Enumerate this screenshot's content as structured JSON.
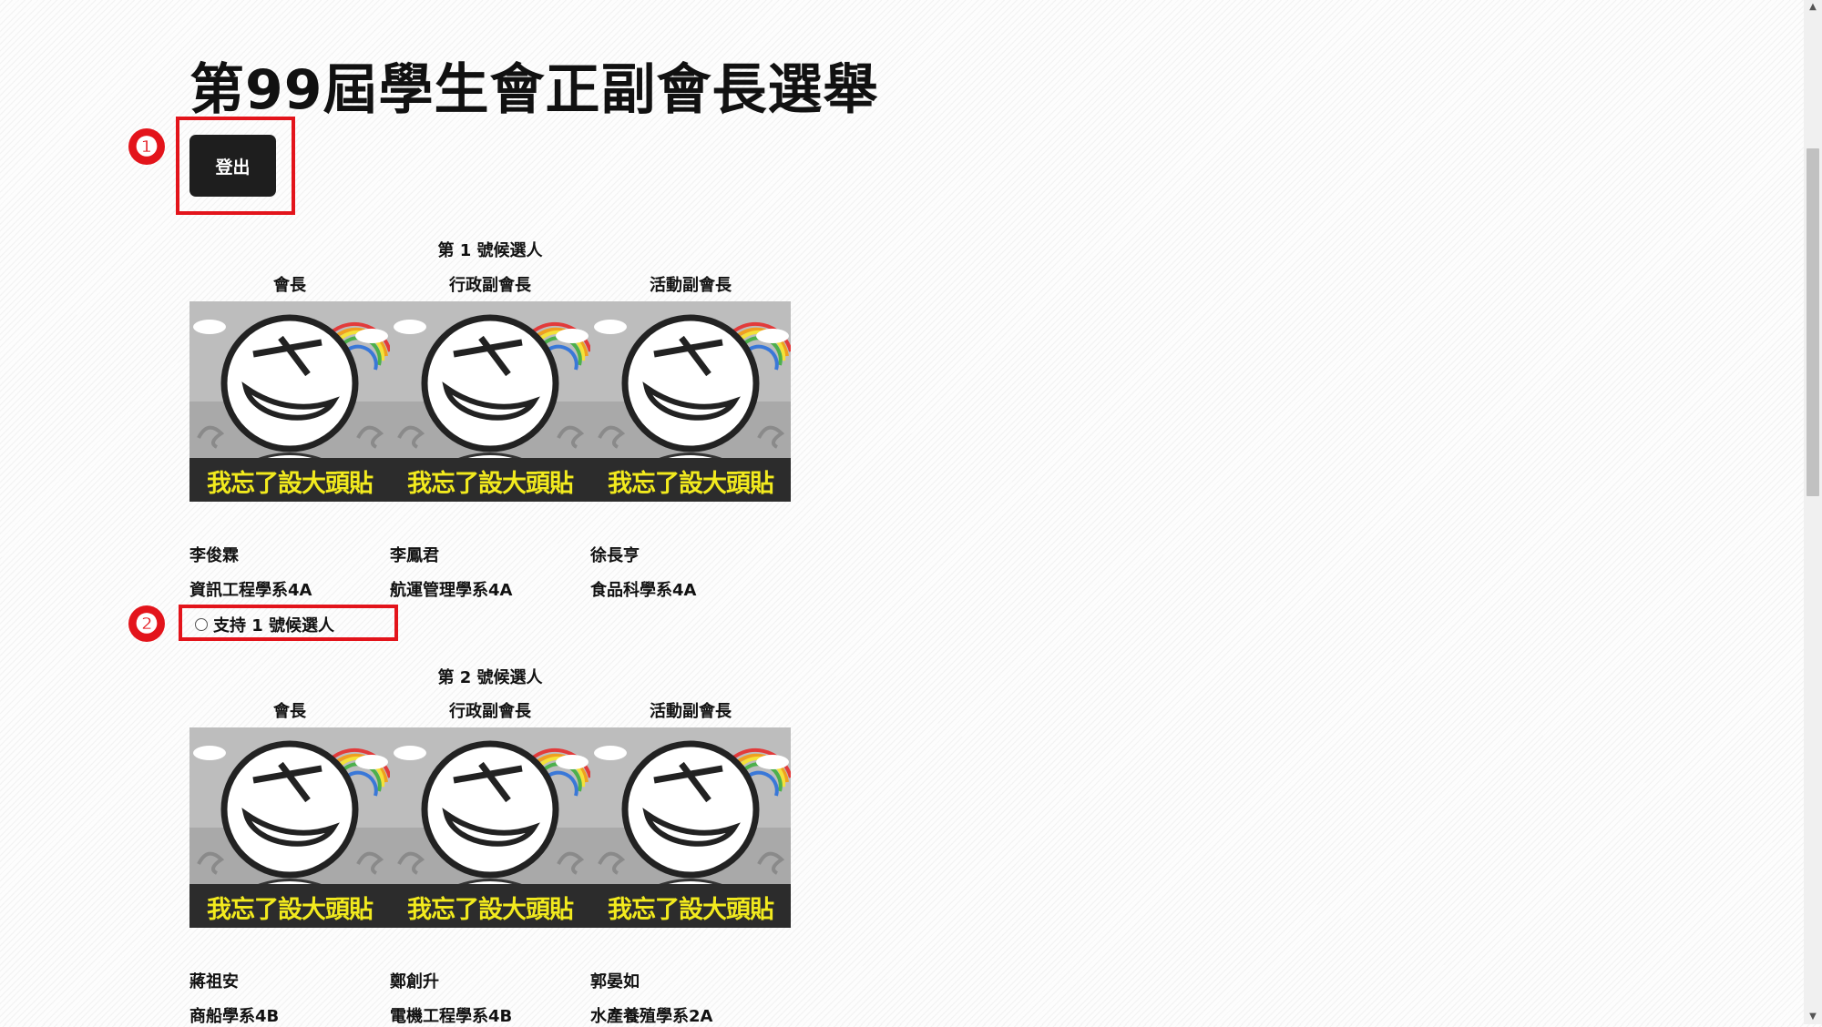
{
  "page_title": "第99屆學生會正副會長選舉",
  "logout_label": "登出",
  "callouts": [
    "❶",
    "❷"
  ],
  "photo_caption": "我忘了設大頭貼",
  "candidates": [
    {
      "group_title": "第 1 號候選人",
      "roles": [
        "會長",
        "行政副會長",
        "活動副會長"
      ],
      "names": [
        "李俊霖",
        "李鳳君",
        "徐長亨"
      ],
      "departments": [
        "資訊工程學系4A",
        "航運管理學系4A",
        "食品科學系4A"
      ],
      "support_label": "支持 1 號候選人"
    },
    {
      "group_title": "第 2 號候選人",
      "roles": [
        "會長",
        "行政副會長",
        "活動副會長"
      ],
      "names": [
        "蔣祖安",
        "鄭創升",
        "郭晏如"
      ],
      "departments": [
        "商船學系4B",
        "電機工程學系4B",
        "水產養殖學系2A"
      ]
    }
  ],
  "scrollbar": {
    "up_arrow": "▲",
    "down_arrow": "▼"
  },
  "colors": {
    "callout": "#e3141b",
    "button": "#1e1e1e",
    "caption": "#f2ea1e"
  }
}
